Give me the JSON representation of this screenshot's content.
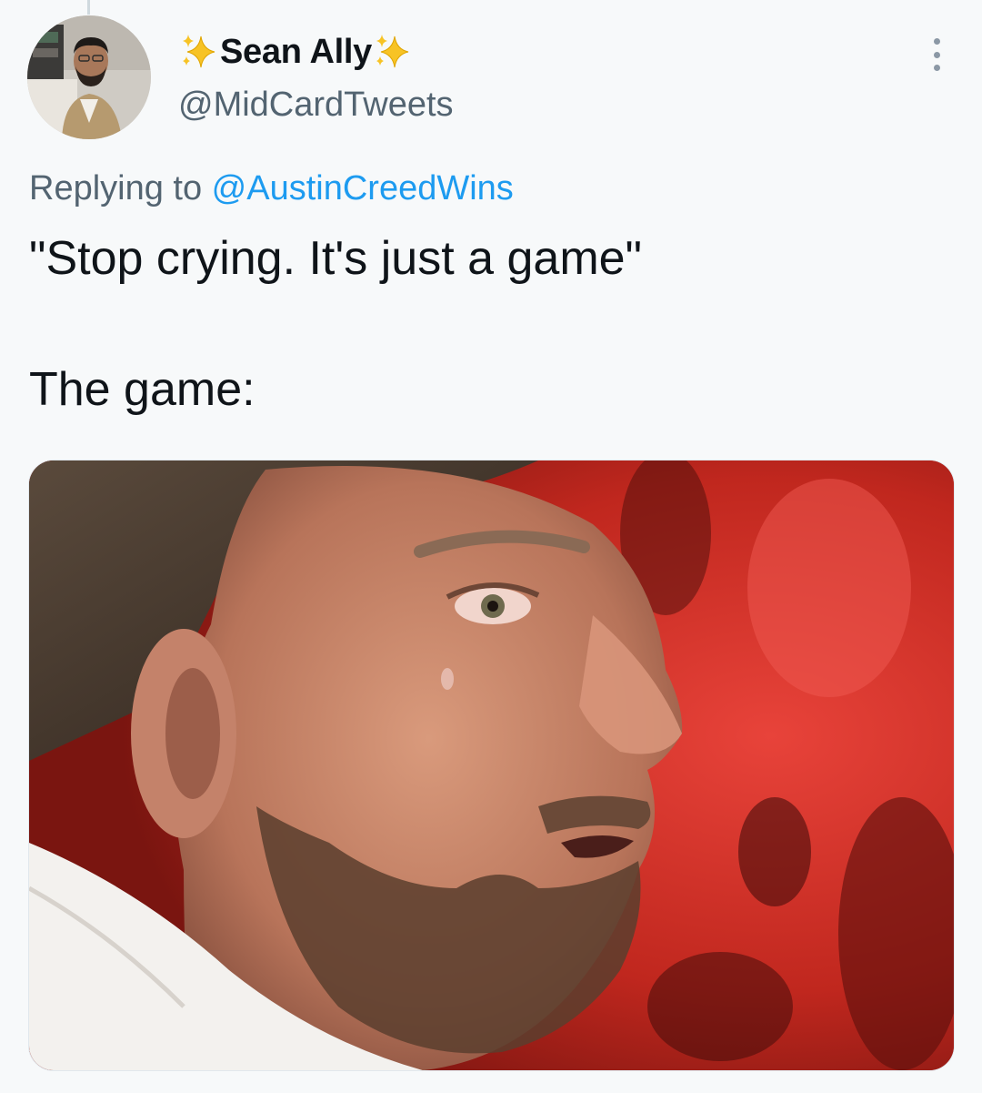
{
  "author": {
    "display_name": "Sean Ally",
    "name_prefix_emoji": "sparkles",
    "name_suffix_emoji": "sparkles",
    "handle": "@MidCardTweets"
  },
  "reply": {
    "prefix": "Replying to ",
    "mention": "@AustinCreedWins"
  },
  "tweet": {
    "line1": "\"Stop crying. It's just a game\"",
    "line2": "The game:"
  },
  "media": {
    "description_icon": "photo",
    "alt": ""
  },
  "colors": {
    "background": "#f7f9fa",
    "text": "#0f1419",
    "secondary": "#536471",
    "link": "#1d9bf0",
    "sparkle": "#f7c325"
  },
  "icons": {
    "more": "more-vertical-icon",
    "sparkle": "sparkles-icon"
  }
}
